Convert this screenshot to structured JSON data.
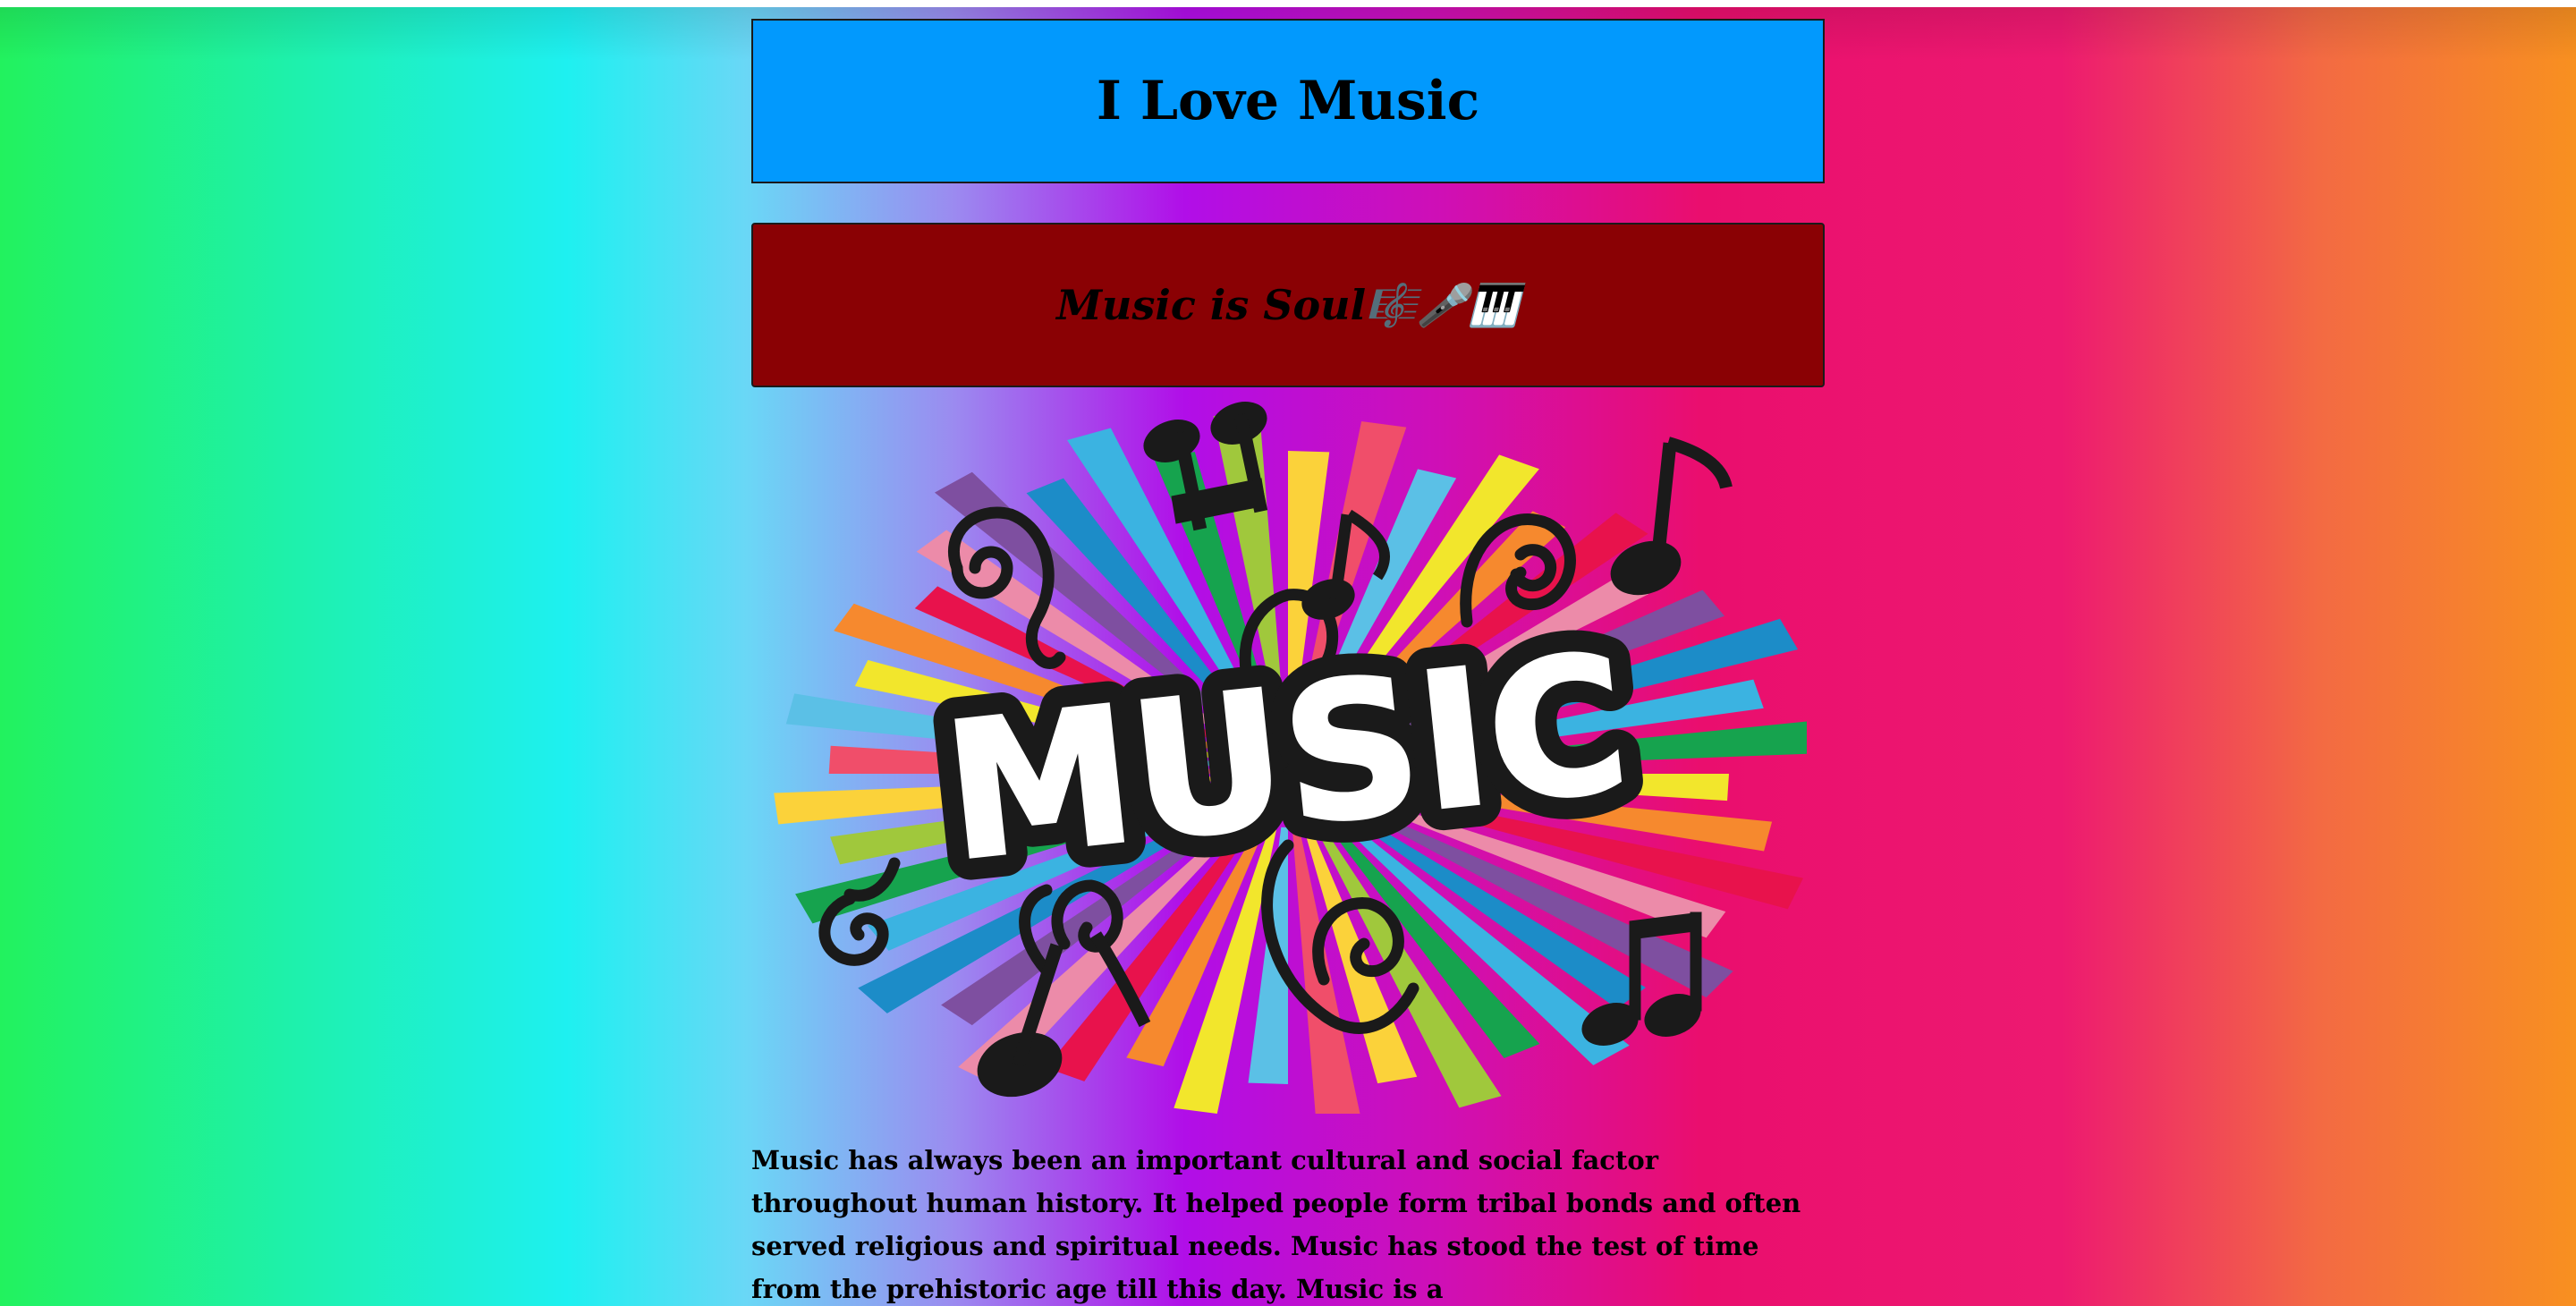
{
  "header": {
    "title": "I Love Music"
  },
  "subheader": {
    "text": "Music is Soul🎼🎤🎹"
  },
  "artwork": {
    "word": "MUSIC",
    "description_icon": "music-burst-image"
  },
  "article": {
    "paragraph": "Music has always been an important cultural and social factor throughout human history. It helped people form tribal bonds and often served religious and spiritual needs. Music has stood the test of time from the prehistoric age till this day. Music is a"
  },
  "colors": {
    "title_bg": "#0299fd",
    "subtitle_bg": "#8a0104",
    "gradient_left": "#22f25e",
    "gradient_mid": "#b10ee8",
    "gradient_right": "#f89020"
  }
}
